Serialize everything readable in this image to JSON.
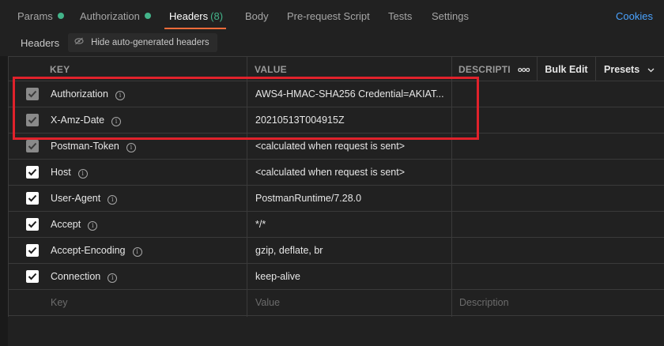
{
  "tabs": [
    {
      "label": "Params",
      "dot": "#43b48a"
    },
    {
      "label": "Authorization",
      "dot": "#43b48a"
    },
    {
      "label": "Headers",
      "count": "(8)"
    },
    {
      "label": "Body"
    },
    {
      "label": "Pre-request Script"
    },
    {
      "label": "Tests"
    },
    {
      "label": "Settings"
    }
  ],
  "cookies_label": "Cookies",
  "subbar": {
    "label": "Headers",
    "hide_button": "Hide auto-generated headers"
  },
  "table": {
    "columns": {
      "key": "KEY",
      "value": "VALUE",
      "description": "DESCRIPTI"
    },
    "more_label": "ooo",
    "bulk_edit": "Bulk Edit",
    "presets": "Presets",
    "rows": [
      {
        "key": "Authorization",
        "value": "AWS4-HMAC-SHA256 Credential=AKIAT...",
        "checkbox": "disabled"
      },
      {
        "key": "X-Amz-Date",
        "value": "20210513T004915Z",
        "checkbox": "disabled"
      },
      {
        "key": "Postman-Token",
        "value": "<calculated when request is sent>",
        "checkbox": "disabled"
      },
      {
        "key": "Host",
        "value": "<calculated when request is sent>",
        "checkbox": "checked"
      },
      {
        "key": "User-Agent",
        "value": "PostmanRuntime/7.28.0",
        "checkbox": "checked"
      },
      {
        "key": "Accept",
        "value": "*/*",
        "checkbox": "checked"
      },
      {
        "key": "Accept-Encoding",
        "value": "gzip, deflate, br",
        "checkbox": "checked"
      },
      {
        "key": "Connection",
        "value": "keep-alive",
        "checkbox": "checked"
      }
    ],
    "placeholders": {
      "key": "Key",
      "value": "Value",
      "description": "Description"
    }
  },
  "colors": {
    "accent": "#f26b3a",
    "highlight_border": "#e0222b",
    "link": "#4aa3ff"
  }
}
